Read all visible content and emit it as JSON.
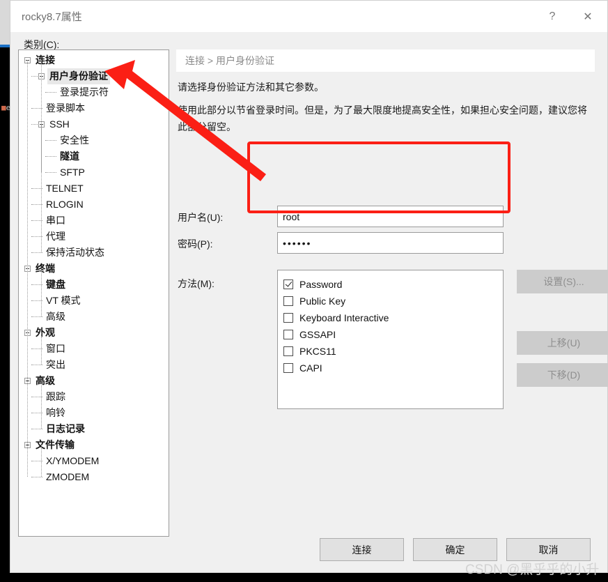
{
  "background": {
    "terminal_fragment": "e"
  },
  "window": {
    "title": "rocky8.7属性",
    "help_label": "?",
    "close_label": "✕"
  },
  "sidebar": {
    "label": "类别(C):",
    "items": [
      {
        "label": "连接",
        "level": 0,
        "expander": true,
        "bold": true,
        "selected": false
      },
      {
        "label": "用户身份验证",
        "level": 1,
        "expander": true,
        "bold": true,
        "selected": true
      },
      {
        "label": "登录提示符",
        "level": 2,
        "expander": false,
        "bold": false,
        "selected": false
      },
      {
        "label": "登录脚本",
        "level": 1,
        "expander": false,
        "bold": false,
        "selected": false
      },
      {
        "label": "SSH",
        "level": 1,
        "expander": true,
        "bold": false,
        "selected": false
      },
      {
        "label": "安全性",
        "level": 2,
        "expander": false,
        "bold": false,
        "selected": false
      },
      {
        "label": "隧道",
        "level": 2,
        "expander": false,
        "bold": true,
        "selected": false
      },
      {
        "label": "SFTP",
        "level": 2,
        "expander": false,
        "bold": false,
        "selected": false
      },
      {
        "label": "TELNET",
        "level": 1,
        "expander": false,
        "bold": false,
        "selected": false
      },
      {
        "label": "RLOGIN",
        "level": 1,
        "expander": false,
        "bold": false,
        "selected": false
      },
      {
        "label": "串口",
        "level": 1,
        "expander": false,
        "bold": false,
        "selected": false
      },
      {
        "label": "代理",
        "level": 1,
        "expander": false,
        "bold": false,
        "selected": false
      },
      {
        "label": "保持活动状态",
        "level": 1,
        "expander": false,
        "bold": false,
        "selected": false
      },
      {
        "label": "终端",
        "level": 0,
        "expander": true,
        "bold": true,
        "selected": false
      },
      {
        "label": "键盘",
        "level": 1,
        "expander": false,
        "bold": true,
        "selected": false
      },
      {
        "label": "VT 模式",
        "level": 1,
        "expander": false,
        "bold": false,
        "selected": false
      },
      {
        "label": "高级",
        "level": 1,
        "expander": false,
        "bold": false,
        "selected": false
      },
      {
        "label": "外观",
        "level": 0,
        "expander": true,
        "bold": true,
        "selected": false
      },
      {
        "label": "窗口",
        "level": 1,
        "expander": false,
        "bold": false,
        "selected": false
      },
      {
        "label": "突出",
        "level": 1,
        "expander": false,
        "bold": false,
        "selected": false
      },
      {
        "label": "高级",
        "level": 0,
        "expander": true,
        "bold": true,
        "selected": false
      },
      {
        "label": "跟踪",
        "level": 1,
        "expander": false,
        "bold": false,
        "selected": false
      },
      {
        "label": "响铃",
        "level": 1,
        "expander": false,
        "bold": false,
        "selected": false
      },
      {
        "label": "日志记录",
        "level": 1,
        "expander": false,
        "bold": true,
        "selected": false
      },
      {
        "label": "文件传输",
        "level": 0,
        "expander": true,
        "bold": true,
        "selected": false
      },
      {
        "label": "X/YMODEM",
        "level": 1,
        "expander": false,
        "bold": false,
        "selected": false
      },
      {
        "label": "ZMODEM",
        "level": 1,
        "expander": false,
        "bold": false,
        "selected": false
      }
    ]
  },
  "content": {
    "breadcrumb": "连接 > 用户身份验证",
    "description_1": "请选择身份验证方法和其它参数。",
    "description_2": "使用此部分以节省登录时间。但是，为了最大限度地提高安全性，如果担心安全问题，建议您将此部分留空。",
    "username": {
      "label": "用户名(U):",
      "value": "root",
      "placeholder": ""
    },
    "password": {
      "label": "密码(P):",
      "value": "••••••",
      "placeholder": ""
    },
    "methods": {
      "label": "方法(M):",
      "items": [
        {
          "label": "Password",
          "checked": true
        },
        {
          "label": "Public Key",
          "checked": false
        },
        {
          "label": "Keyboard Interactive",
          "checked": false
        },
        {
          "label": "GSSAPI",
          "checked": false
        },
        {
          "label": "PKCS11",
          "checked": false
        },
        {
          "label": "CAPI",
          "checked": false
        }
      ]
    },
    "side_buttons": {
      "settings": "设置(S)...",
      "move_up": "上移(U)",
      "move_down": "下移(D)"
    }
  },
  "footer": {
    "connect": "连接",
    "ok": "确定",
    "cancel": "取消"
  },
  "watermark": "CSDN @黑乎乎的小升",
  "colors": {
    "annotation": "#fb1f15",
    "dialog_bg": "#f0f0f0",
    "selection": "#e8e8e8",
    "disabled_button": "#cccccc"
  }
}
